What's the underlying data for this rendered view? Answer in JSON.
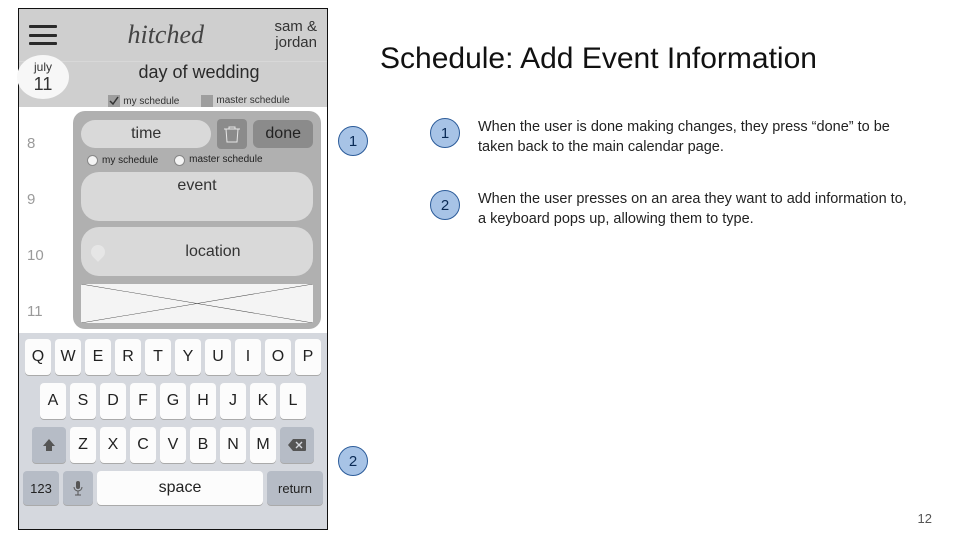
{
  "slide": {
    "title": "Schedule: Add Event Information",
    "page_number": "12"
  },
  "annotations": [
    {
      "num": "1",
      "text": "When the user is done making changes, they press “done” to be taken back to the main calendar page."
    },
    {
      "num": "2",
      "text": "When the user presses on an area they want to add information to, a keyboard pops up, allowing them to type."
    }
  ],
  "callouts": {
    "c1": "1",
    "c2": "2"
  },
  "phone": {
    "brand": "hitched",
    "user_line1": "sam &",
    "user_line2": "jordan",
    "date_month": "july",
    "date_day": "11",
    "bar2_title": "day of wedding",
    "filter_my": "my schedule",
    "filter_master": "master schedule",
    "hours": [
      "8",
      "9",
      "10",
      "11"
    ],
    "panel": {
      "time_label": "time",
      "done_label": "done",
      "radio_my": "my schedule",
      "radio_master": "master schedule",
      "event_label": "event",
      "location_label": "location"
    },
    "keyboard": {
      "row1": [
        "Q",
        "W",
        "E",
        "R",
        "T",
        "Y",
        "U",
        "I",
        "O",
        "P"
      ],
      "row2": [
        "A",
        "S",
        "D",
        "F",
        "G",
        "H",
        "J",
        "K",
        "L"
      ],
      "row3": [
        "Z",
        "X",
        "C",
        "V",
        "B",
        "N",
        "M"
      ],
      "num_key": "123",
      "space": "space",
      "return": "return"
    }
  }
}
